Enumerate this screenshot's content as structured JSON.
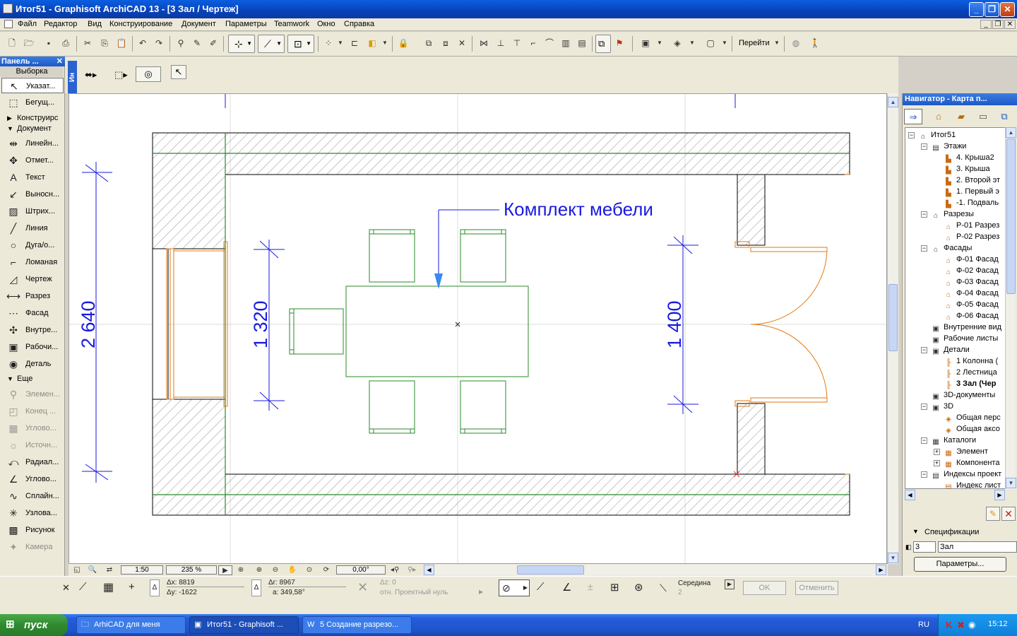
{
  "window": {
    "title": "Итог51 - Graphisoft ArchiCAD 13 - [3 Зал / Чертеж]",
    "min": "_",
    "max": "❐",
    "close": "✕"
  },
  "menu": [
    "Файл",
    "Редактор",
    "Вид",
    "Конструирование",
    "Документ",
    "Параметры",
    "Teamwork",
    "Окно",
    "Справка"
  ],
  "toolbar": {
    "goto_label": "Перейти",
    "icons": [
      "new-icon",
      "open-icon",
      "save-icon",
      "print-icon",
      "cut-icon",
      "copy-icon",
      "paste-icon",
      "undo-icon",
      "redo-icon"
    ]
  },
  "toolbox": {
    "title": "Панель ...",
    "close": "✕",
    "selection_header": "Выборка",
    "select_tools": [
      {
        "label": "Указат...",
        "icon": "arrow-icon",
        "glyph": "↖"
      },
      {
        "label": "Бегущ...",
        "icon": "marquee-icon",
        "glyph": "⬚"
      }
    ],
    "groups": {
      "construct": "Конструирс",
      "document": "Документ",
      "more": "Еще"
    },
    "doc_tools": [
      {
        "label": "Линейн...",
        "glyph": "⇹"
      },
      {
        "label": "Отмет...",
        "glyph": "✥"
      },
      {
        "label": "Текст",
        "glyph": "A"
      },
      {
        "label": "Выносн...",
        "glyph": "↙"
      },
      {
        "label": "Штрих...",
        "glyph": "▨"
      },
      {
        "label": "Линия",
        "glyph": "╱"
      },
      {
        "label": "Дуга/о...",
        "glyph": "○"
      },
      {
        "label": "Ломаная",
        "glyph": "⌐"
      },
      {
        "label": "Чертеж",
        "glyph": "◿"
      },
      {
        "label": "Разрез",
        "glyph": "⟷"
      },
      {
        "label": "Фасад",
        "glyph": "⋯"
      },
      {
        "label": "Внутре...",
        "glyph": "✣"
      },
      {
        "label": "Рабочи...",
        "glyph": "▣"
      },
      {
        "label": "Деталь",
        "glyph": "◉"
      }
    ],
    "more_tools": [
      {
        "label": "Элемен...",
        "glyph": "⚲",
        "disabled": true
      },
      {
        "label": "Конец ...",
        "glyph": "◰",
        "disabled": true
      },
      {
        "label": "Углово...",
        "glyph": "▦",
        "disabled": true
      },
      {
        "label": "Источн...",
        "glyph": "☼",
        "disabled": true
      },
      {
        "label": "Радиал...",
        "glyph": "⤺",
        "disabled": false
      },
      {
        "label": "Углово...",
        "glyph": "∠",
        "disabled": false
      },
      {
        "label": "Сплайн...",
        "glyph": "∿",
        "disabled": false
      },
      {
        "label": "Узлова...",
        "glyph": "✳",
        "disabled": false
      },
      {
        "label": "Рисунок",
        "glyph": "▩",
        "disabled": false
      },
      {
        "label": "Камера",
        "glyph": "✦",
        "disabled": true
      }
    ]
  },
  "infobox": {
    "label": "Ин"
  },
  "drawing": {
    "annotation": "Комплект мебели",
    "dim_left": "2 640",
    "dim_table": "1 320",
    "dim_right": "1 400"
  },
  "bottom": {
    "scale": "1:50",
    "zoom": "235 %",
    "angle": "0,00°"
  },
  "navigator": {
    "title": "Навигатор - Карта п...",
    "tree": [
      {
        "label": "Итог51",
        "level": 0,
        "toggle": "−",
        "glyph": "⌂"
      },
      {
        "label": "Этажи",
        "level": 1,
        "toggle": "−",
        "glyph": "▤"
      },
      {
        "label": "4. Крыша2",
        "level": 2,
        "glyph": "▙"
      },
      {
        "label": "3. Крыша",
        "level": 2,
        "glyph": "▙"
      },
      {
        "label": "2. Второй эт",
        "level": 2,
        "glyph": "▙"
      },
      {
        "label": "1. Первый э",
        "level": 2,
        "glyph": "▙"
      },
      {
        "label": "-1. Подваль",
        "level": 2,
        "glyph": "▙"
      },
      {
        "label": "Разрезы",
        "level": 1,
        "toggle": "−",
        "glyph": "⌂"
      },
      {
        "label": "Р-01 Разрез",
        "level": 2,
        "glyph": "⌂"
      },
      {
        "label": "Р-02 Разрез",
        "level": 2,
        "glyph": "⌂"
      },
      {
        "label": "Фасады",
        "level": 1,
        "toggle": "−",
        "glyph": "⌂"
      },
      {
        "label": "Ф-01 Фасад",
        "level": 2,
        "glyph": "⌂"
      },
      {
        "label": "Ф-02 Фасад",
        "level": 2,
        "glyph": "⌂"
      },
      {
        "label": "Ф-03 Фасад",
        "level": 2,
        "glyph": "⌂"
      },
      {
        "label": "Ф-04 Фасад",
        "level": 2,
        "glyph": "⌂"
      },
      {
        "label": "Ф-05 Фасад",
        "level": 2,
        "glyph": "⌂"
      },
      {
        "label": "Ф-06 Фасад",
        "level": 2,
        "glyph": "⌂"
      },
      {
        "label": "Внутренние вид",
        "level": 1,
        "glyph": "▣"
      },
      {
        "label": "Рабочие листы",
        "level": 1,
        "glyph": "▣"
      },
      {
        "label": "Детали",
        "level": 1,
        "toggle": "−",
        "glyph": "▣"
      },
      {
        "label": "1 Колонна (",
        "level": 2,
        "glyph": "╟"
      },
      {
        "label": "2 Лестница",
        "level": 2,
        "glyph": "╟"
      },
      {
        "label": "3 Зал (Чер",
        "level": 2,
        "glyph": "╟",
        "current": true
      },
      {
        "label": "3D-документы",
        "level": 1,
        "glyph": "▣"
      },
      {
        "label": "3D",
        "level": 1,
        "toggle": "−",
        "glyph": "▣"
      },
      {
        "label": "Общая перс",
        "level": 2,
        "glyph": "◈"
      },
      {
        "label": "Общая аксо",
        "level": 2,
        "glyph": "◈"
      },
      {
        "label": "Каталоги",
        "level": 1,
        "toggle": "−",
        "glyph": "▦"
      },
      {
        "label": "Элемент",
        "level": 2,
        "toggle": "+",
        "glyph": "▦"
      },
      {
        "label": "Компонента",
        "level": 2,
        "toggle": "+",
        "glyph": "▦"
      },
      {
        "label": "Индексы проект",
        "level": 1,
        "toggle": "−",
        "glyph": "▤"
      },
      {
        "label": "Индекс лист",
        "level": 2,
        "glyph": "▤"
      }
    ],
    "specs_header": "Спецификации",
    "spec_id": "3",
    "spec_name": "Зал",
    "params_button": "Параметры..."
  },
  "coords": {
    "dx": "Δx: 8819",
    "dy": "Δy: -1622",
    "dr": "Δr: 8967",
    "da": "a: 349,58°",
    "dz": "Δz: 0",
    "zero": "отн. Проектный нуль",
    "snap": "Середина",
    "snap_n": "2",
    "ok": "OK",
    "cancel": "Отменить"
  },
  "taskbar": {
    "start": "пуск",
    "tasks": [
      {
        "label": "ArhiCAD для меня",
        "active": false,
        "icon": "folder-icon"
      },
      {
        "label": "Итог51 - Graphisoft ...",
        "active": true,
        "icon": "archicad-icon"
      },
      {
        "label": "5 Создание разрезо...",
        "active": false,
        "icon": "word-icon"
      }
    ],
    "lang": "RU",
    "time": "15:12"
  }
}
